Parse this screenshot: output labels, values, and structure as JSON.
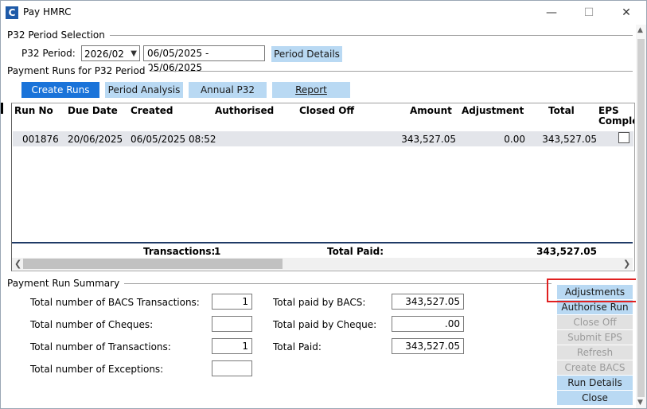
{
  "window": {
    "app_icon_letter": "C",
    "title": "Pay HMRC",
    "minimize_glyph": "—",
    "maximize_glyph": "☐",
    "close_glyph": "✕"
  },
  "p32_selection": {
    "section_label": "P32 Period Selection",
    "period_label": "P32 Period:",
    "period_value": "2026/02",
    "date_range": "06/05/2025 - 05/06/2025",
    "period_details_button": "Period Details"
  },
  "payment_runs": {
    "section_label": "Payment Runs for P32 Period",
    "buttons": {
      "create_runs": "Create Runs",
      "period_analysis": "Period Analysis",
      "annual_p32": "Annual P32",
      "report": "Report"
    },
    "columns": [
      "Run No",
      "Due Date",
      "Created",
      "Authorised",
      "Closed Off",
      "Amount",
      "Adjustment",
      "Total",
      "EPS",
      "Comple"
    ],
    "rows": [
      {
        "run_no": "001876",
        "due_date": "20/06/2025",
        "created": "06/05/2025 08:52",
        "authorised": "",
        "closed_off": "",
        "amount": "343,527.05",
        "adjustment": "0.00",
        "total": "343,527.05",
        "eps_complete": false
      }
    ],
    "footer": {
      "transactions_label": "Transactions:",
      "transactions_value": "1",
      "total_paid_label": "Total Paid:",
      "total_paid_value": "343,527.05"
    }
  },
  "summary": {
    "section_label": "Payment Run Summary",
    "bacs_transactions_label": "Total number of BACS Transactions:",
    "bacs_transactions_value": "1",
    "cheques_label": "Total number of Cheques:",
    "cheques_value": "",
    "transactions_label": "Total number of Transactions:",
    "transactions_value": "1",
    "exceptions_label": "Total number of Exceptions:",
    "exceptions_value": "",
    "paid_bacs_label": "Total paid by BACS:",
    "paid_bacs_value": "343,527.05",
    "paid_cheque_label": "Total paid by Cheque:",
    "paid_cheque_value": ".00",
    "total_paid_label": "Total Paid:",
    "total_paid_value": "343,527.05"
  },
  "side_buttons": {
    "adjustments": "Adjustments",
    "authorise_run": "Authorise Run",
    "close_off": "Close Off",
    "submit_eps": "Submit EPS",
    "refresh": "Refresh",
    "create_bacs": "Create BACS",
    "run_details": "Run Details",
    "close": "Close"
  },
  "colors": {
    "primary_button": "#1a73d9",
    "secondary_button": "#b9d9f3",
    "disabled_button": "#e1e1e1",
    "highlight_box": "#e02020",
    "total_line": "#1f3a66"
  }
}
